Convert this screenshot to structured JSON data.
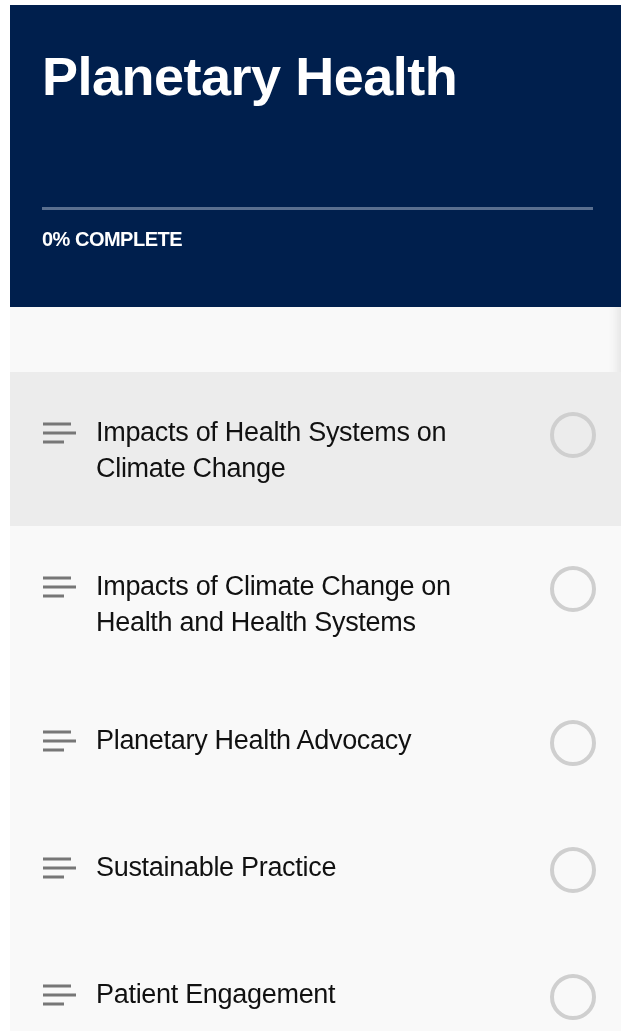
{
  "course": {
    "title": "Planetary Health",
    "progress": {
      "level": 0,
      "label": "0% COMPLETE"
    }
  },
  "lessons": [
    {
      "title": "Impacts of Health Systems on Climate Change",
      "selected": true,
      "completed": false
    },
    {
      "title": "Impacts of Climate Change on Health and Health Systems",
      "selected": false,
      "completed": false
    },
    {
      "title": "Planetary Health Advocacy",
      "selected": false,
      "completed": false
    },
    {
      "title": "Sustainable Practice",
      "selected": false,
      "completed": false
    },
    {
      "title": "Patient Engagement",
      "selected": false,
      "completed": false
    }
  ]
}
